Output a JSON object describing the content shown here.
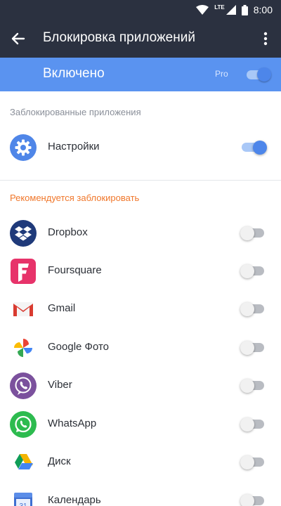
{
  "statusbar": {
    "time": "8:00",
    "network": "LTE"
  },
  "appbar": {
    "title": "Блокировка приложений",
    "back_icon": "arrow-left",
    "menu_icon": "more-vert"
  },
  "master": {
    "label": "Включено",
    "pro_label": "Pro",
    "enabled": true
  },
  "locked_section": {
    "header": "Заблокированные приложения",
    "apps": [
      {
        "name": "Настройки",
        "icon": "settings-gear",
        "locked": true
      }
    ]
  },
  "recommended_section": {
    "header": "Рекомендуется заблокировать",
    "apps": [
      {
        "name": "Dropbox",
        "icon": "dropbox",
        "locked": false
      },
      {
        "name": "Foursquare",
        "icon": "foursquare",
        "locked": false
      },
      {
        "name": "Gmail",
        "icon": "gmail",
        "locked": false
      },
      {
        "name": "Google Фото",
        "icon": "google-photos",
        "locked": false
      },
      {
        "name": "Viber",
        "icon": "viber",
        "locked": false
      },
      {
        "name": "WhatsApp",
        "icon": "whatsapp",
        "locked": false
      },
      {
        "name": "Диск",
        "icon": "google-drive",
        "locked": false
      },
      {
        "name": "Календарь",
        "icon": "calendar",
        "locked": false
      }
    ]
  },
  "colors": {
    "appbar": "#2b3140",
    "accent": "#5a93f0",
    "switch_on": "#4d86ea",
    "recommended_header": "#f0772b"
  }
}
